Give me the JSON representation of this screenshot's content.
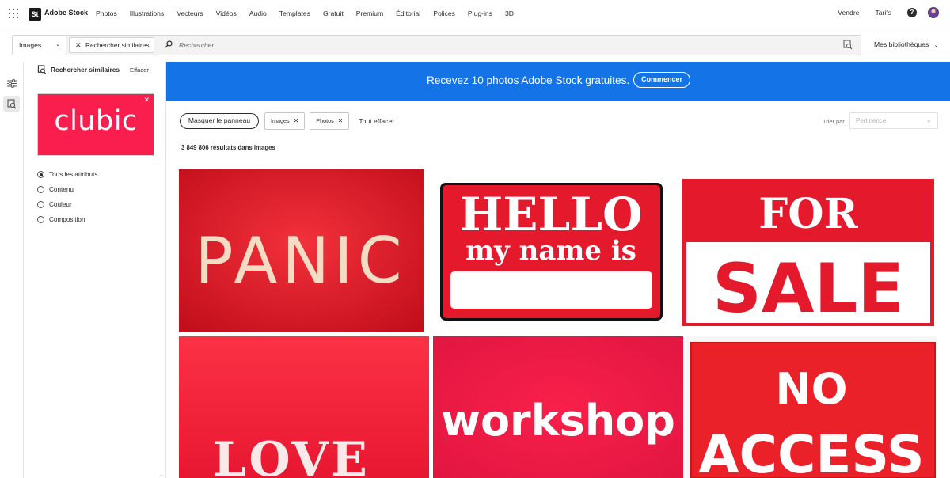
{
  "topnav": {
    "logo_box": "St",
    "logo_text": "Adobe Stock",
    "items": [
      "Photos",
      "Illustrations",
      "Vecteurs",
      "Vidéos",
      "Audio",
      "Templates",
      "Gratuit",
      "Premium",
      "Éditorial",
      "Polices",
      "Plug-ins",
      "3D"
    ],
    "sell": "Vendre",
    "pricing": "Tarifs",
    "help": "?"
  },
  "search": {
    "type_value": "Images",
    "similar_chip": "Rechercher similaires:",
    "placeholder": "Rechercher",
    "libraries": "Mes bibliothèques"
  },
  "panel": {
    "title": "Rechercher similaires",
    "clear": "Effacer",
    "thumb_text": "clubic",
    "options": [
      "Tous les attributs",
      "Contenu",
      "Couleur",
      "Composition"
    ],
    "selected_index": 0
  },
  "promo": {
    "text": "Recevez 10 photos Adobe Stock gratuites.",
    "button": "Commencer"
  },
  "filters": {
    "hide_panel": "Masquer le panneau",
    "chips": [
      "Images",
      "Photos"
    ],
    "clear_all": "Tout effacer",
    "sort_label": "Trier par",
    "sort_value": "Pertinence"
  },
  "results": {
    "count_text": "3 849 806 résultats dans images"
  },
  "grid": {
    "img1_text": "PANIC",
    "img2_line1": "HELLO",
    "img2_line2": "my name is",
    "img3_line1": "FOR",
    "img3_line2": "SALE",
    "img4_text": "LOVE",
    "img5_text": "workshop",
    "img6_line1": "NO",
    "img6_line2": "ACCESS"
  },
  "colors": {
    "promo_blue": "#1473e6",
    "clubic_red": "#fa1e4e",
    "sign_red": "#e4192c"
  }
}
